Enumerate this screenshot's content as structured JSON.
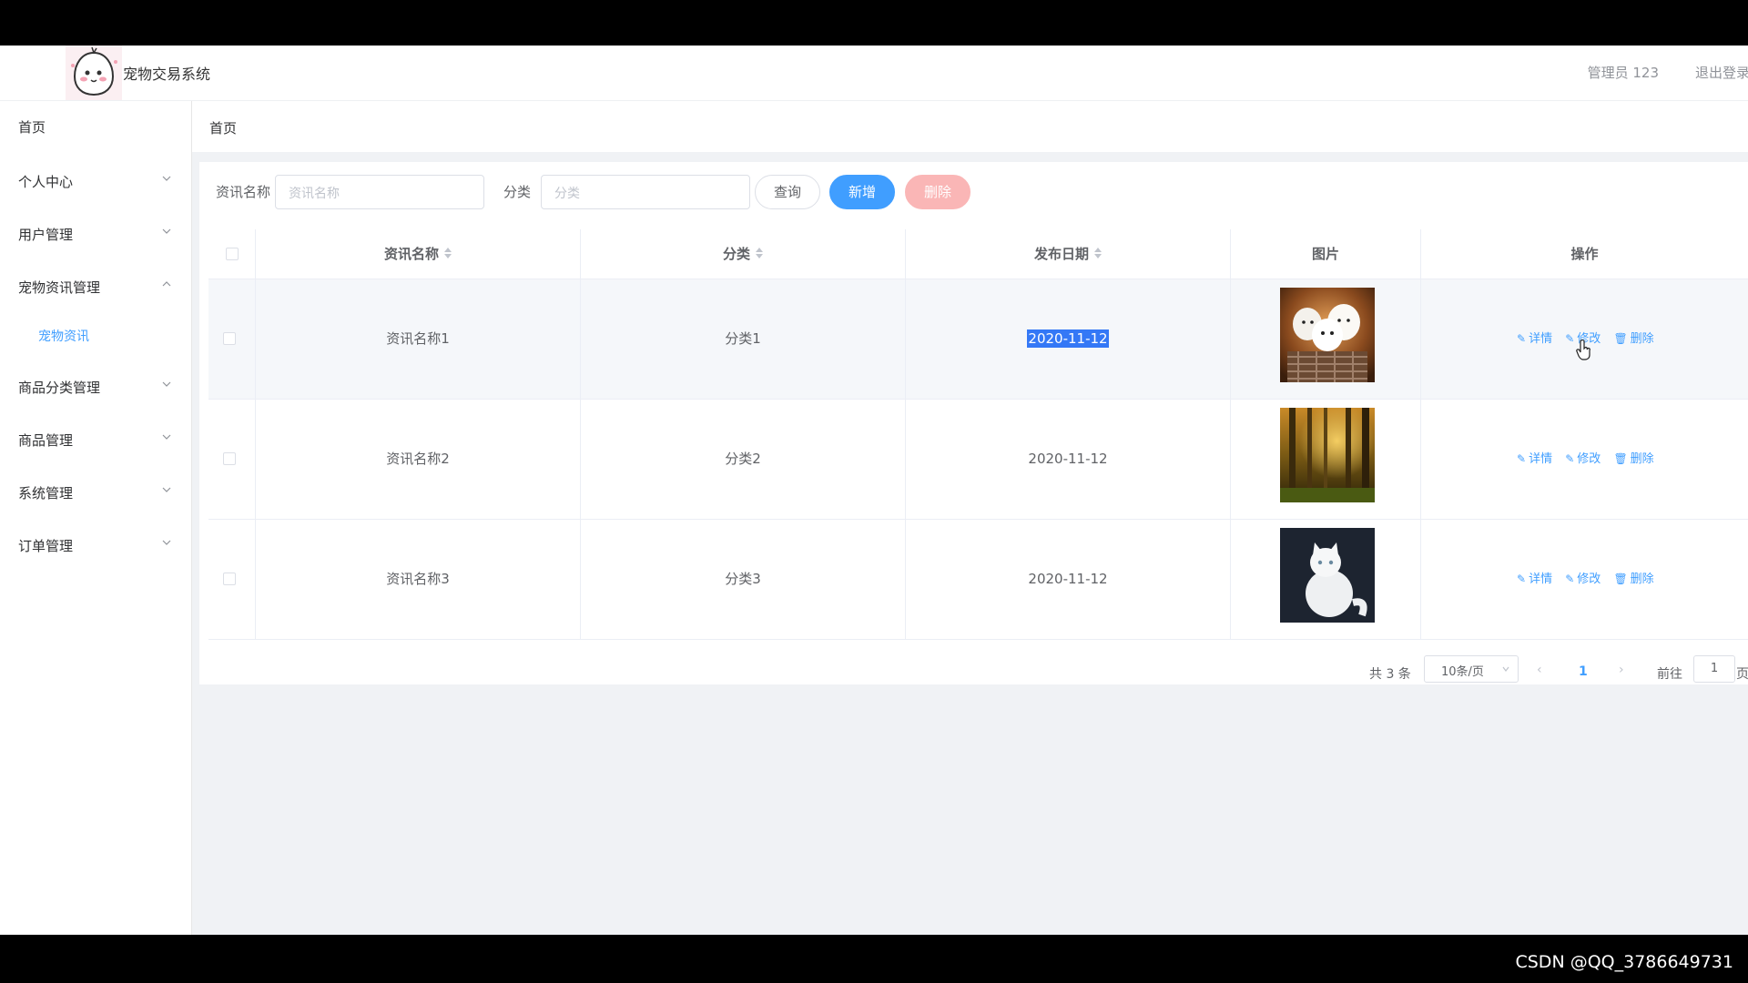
{
  "header": {
    "title": "宠物交易系统",
    "admin": "管理员 123",
    "logout": "退出登录"
  },
  "sidebar": {
    "items": [
      {
        "label": "首页",
        "expandable": false
      },
      {
        "label": "个人中心",
        "expandable": true
      },
      {
        "label": "用户管理",
        "expandable": true
      },
      {
        "label": "宠物资讯管理",
        "expandable": true,
        "open": true,
        "children": [
          "宠物资讯"
        ]
      },
      {
        "label": "商品分类管理",
        "expandable": true
      },
      {
        "label": "商品管理",
        "expandable": true
      },
      {
        "label": "系统管理",
        "expandable": true
      },
      {
        "label": "订单管理",
        "expandable": true
      }
    ]
  },
  "breadcrumb": "首页",
  "search": {
    "name_label": "资讯名称",
    "name_placeholder": "资讯名称",
    "category_label": "分类",
    "category_placeholder": "分类",
    "query": "查询",
    "add": "新增",
    "delete": "删除"
  },
  "table": {
    "columns": [
      "资讯名称",
      "分类",
      "发布日期",
      "图片",
      "操作"
    ],
    "rows": [
      {
        "name": "资讯名称1",
        "category": "分类1",
        "date": "2020-11-12",
        "image": "puppies-photo",
        "selected_text": true
      },
      {
        "name": "资讯名称2",
        "category": "分类2",
        "date": "2020-11-12",
        "image": "forest-photo"
      },
      {
        "name": "资讯名称3",
        "category": "分类3",
        "date": "2020-11-12",
        "image": "white-cat-photo"
      }
    ],
    "actions": {
      "detail": "详情",
      "edit": "修改",
      "remove": "删除"
    }
  },
  "pagination": {
    "total": "共 3 条",
    "page_size": "10条/页",
    "current": "1",
    "goto_label": "前往",
    "goto_value": "1",
    "page_suffix": "页"
  },
  "watermark": "CSDN @QQ_3786649731",
  "colors": {
    "primary": "#409eff",
    "danger_light": "#fab6b6",
    "selection": "#3478f6"
  }
}
